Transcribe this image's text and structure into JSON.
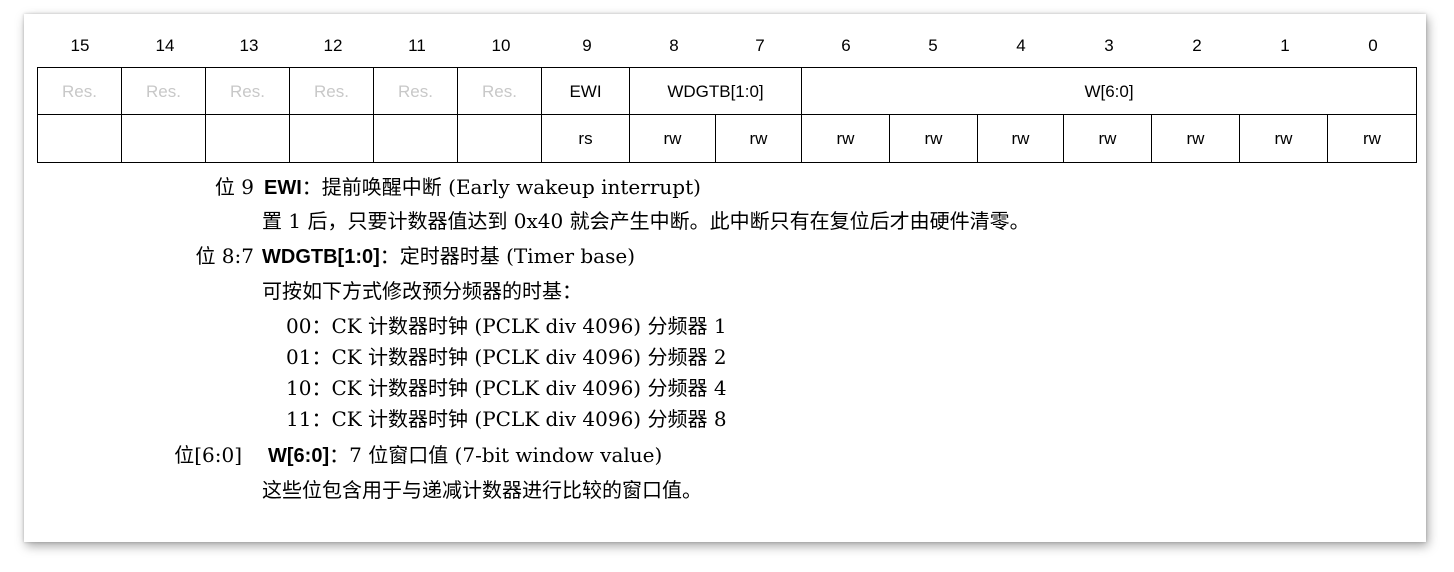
{
  "bit_numbers": [
    "15",
    "14",
    "13",
    "12",
    "11",
    "10",
    "9",
    "8",
    "7",
    "6",
    "5",
    "4",
    "3",
    "2",
    "1",
    "0"
  ],
  "fields": {
    "res_label": "Res.",
    "ewi": "EWI",
    "wdgtb": "WDGTB[1:0]",
    "w": "W[6:0]"
  },
  "access": {
    "ewi": "rs",
    "rw": "rw"
  },
  "description": {
    "bit9_label": "位 9",
    "bit9_name": "EWI",
    "bit9_title": "：提前唤醒中断 (Early wakeup interrupt)",
    "bit9_text": "置 1 后，只要计数器值达到 0x40 就会产生中断。此中断只有在复位后才由硬件清零。",
    "bit87_label": "位 8:7",
    "bit87_name": "WDGTB[1:0]",
    "bit87_title": "：定时器时基 (Timer base)",
    "bit87_text": "可按如下方式修改预分频器的时基：",
    "options": [
      "00：CK 计数器时钟 (PCLK div 4096) 分频器 1",
      "01：CK 计数器时钟 (PCLK div 4096) 分频器 2",
      "10：CK 计数器时钟 (PCLK div 4096) 分频器 4",
      "11：CK 计数器时钟 (PCLK div 4096) 分频器 8"
    ],
    "bit60_label": "位[6:0]",
    "bit60_name": "W[6:0]",
    "bit60_title": "：7 位窗口值 (7-bit window value)",
    "bit60_text": "这些位包含用于与递减计数器进行比较的窗口值。"
  }
}
